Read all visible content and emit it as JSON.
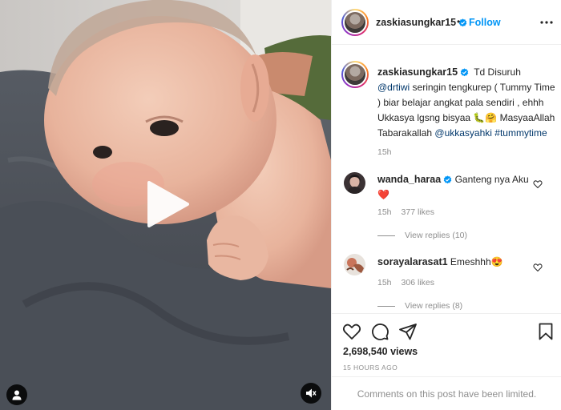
{
  "post": {
    "username": "zaskiasungkar15",
    "follow_label": "Follow",
    "separator": "•",
    "caption": {
      "prefix": "Td Disuruh",
      "mention_1": "@drtiwi",
      "middle": "seringin tengkurep ( Tummy Time ) biar belajar angkat pala sendiri , ehhh Ukkasya lgsng bisyaa 🐛🤗 MasyaaAllah Tabarakallah",
      "mention_2": "@ukkasyahki",
      "hashtag": "#tummytime",
      "time": "15h"
    },
    "views": "2,698,540 views",
    "posted": "15 HOURS AGO",
    "comments_limited": "Comments on this post have been limited."
  },
  "comments": [
    {
      "username": "wanda_haraa",
      "text": "Ganteng nya Aku ❤️",
      "time": "15h",
      "likes": "377 likes",
      "replies": "View replies (10)"
    },
    {
      "username": "sorayalarasat1",
      "text": "Emeshhh😍",
      "time": "15h",
      "likes": "306 likes",
      "replies": "View replies (8)"
    }
  ],
  "icons": {
    "verified": "verified-badge-icon",
    "more": "more-options-icon",
    "like": "heart-icon",
    "comment": "comment-icon",
    "share": "share-icon",
    "save": "bookmark-icon",
    "play": "play-icon",
    "tag": "user-tag-icon",
    "audio": "audio-muted-icon"
  },
  "colors": {
    "accent": "#0095f6",
    "verified": "#0095f6",
    "heart_red": "#ed4956",
    "text": "#262626",
    "muted": "#8e8e8e"
  }
}
